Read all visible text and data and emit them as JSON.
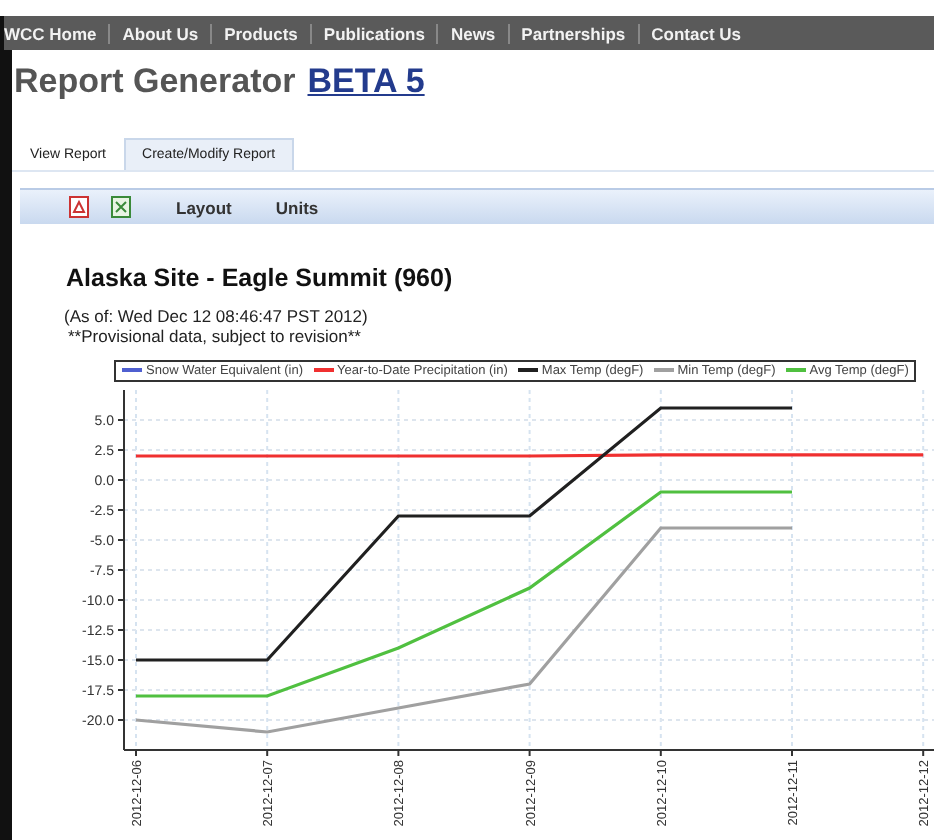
{
  "nav": [
    "WCC Home",
    "About Us",
    "Products",
    "Publications",
    "News",
    "Partnerships",
    "Contact Us"
  ],
  "title": {
    "text": "Report Generator",
    "link": "BETA 5"
  },
  "tabs": [
    {
      "label": "View Report",
      "selected": true
    },
    {
      "label": "Create/Modify Report",
      "selected": false
    }
  ],
  "toolbar": [
    "Layout",
    "Units"
  ],
  "report": {
    "title": "Alaska Site - Eagle Summit (960)",
    "timestamp": "(As of: Wed Dec 12 08:46:47 PST 2012)",
    "note": "**Provisional data, subject to revision**",
    "chart_data": {
      "type": "line",
      "grid": true,
      "categories": [
        "2012-12-06",
        "2012-12-07",
        "2012-12-08",
        "2012-12-09",
        "2012-12-10",
        "2012-12-11",
        "2012-12-12"
      ],
      "ylim": [
        -22.5,
        7.5
      ],
      "yticks": [
        {
          "value": 5,
          "label": "5.0"
        },
        {
          "value": 2.5,
          "label": "2.5"
        },
        {
          "value": 0,
          "label": "0.0"
        },
        {
          "value": -2.5,
          "label": "-2.5"
        },
        {
          "value": -5,
          "label": "-5.0"
        },
        {
          "value": -7.5,
          "label": "-7.5"
        },
        {
          "value": -10,
          "label": "-10.0"
        },
        {
          "value": -12.5,
          "label": "-12.5"
        },
        {
          "value": -15,
          "label": "-15.0"
        },
        {
          "value": -17.5,
          "label": "-17.5"
        },
        {
          "value": -20,
          "label": "-20.0"
        }
      ],
      "series": [
        {
          "name": "Snow Water Equivalent (in)",
          "color": "#4f5fd0",
          "values": [
            null,
            null,
            null,
            null,
            null,
            null,
            null
          ]
        },
        {
          "name": "Year-to-Date Precipitation (in)",
          "color": "#f03030",
          "values": [
            2,
            2,
            2,
            2,
            2.1,
            2.1,
            2.1
          ]
        },
        {
          "name": "Max Temp (degF)",
          "color": "#202020",
          "values": [
            -15,
            -15,
            -3,
            -3,
            6,
            6,
            null
          ]
        },
        {
          "name": "Min Temp (degF)",
          "color": "#a0a0a0",
          "values": [
            -20,
            -21,
            -19,
            -17,
            -4,
            -4,
            null
          ]
        },
        {
          "name": "Avg Temp (degF)",
          "color": "#50c040",
          "values": [
            -18,
            -18,
            -14,
            -9,
            -1,
            -1,
            null
          ]
        }
      ]
    }
  }
}
